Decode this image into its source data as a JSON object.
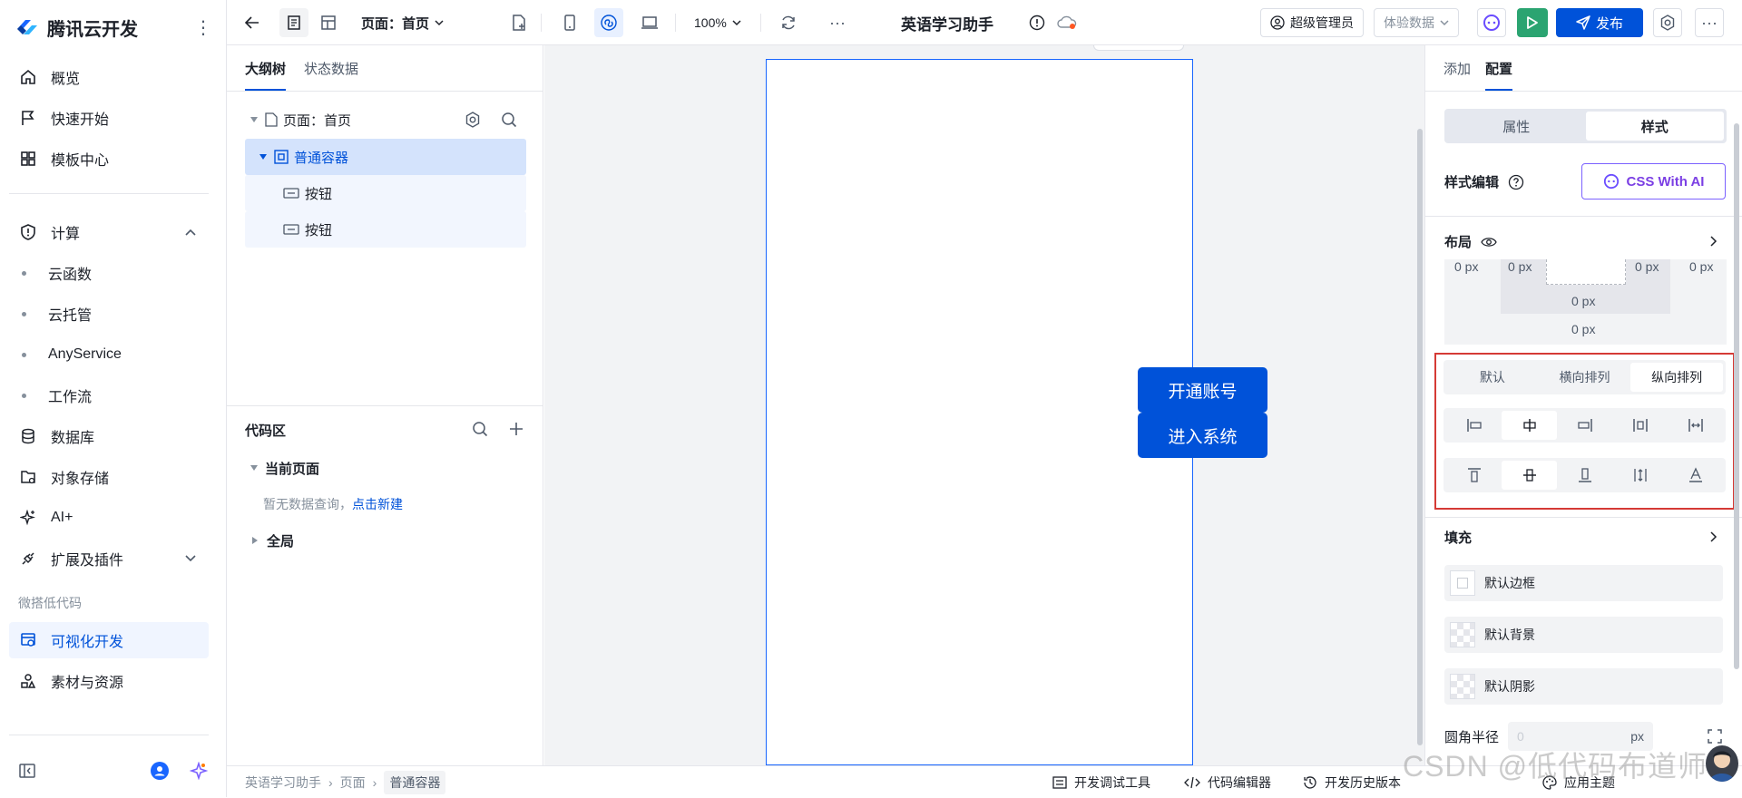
{
  "nav": {
    "brand": "腾讯云开发",
    "items": [
      {
        "label": "概览",
        "icon": "home-icon"
      },
      {
        "label": "快速开始",
        "icon": "flag-icon"
      },
      {
        "label": "模板中心",
        "icon": "grid-icon"
      },
      {
        "label": "计算",
        "icon": "shield-icon"
      },
      {
        "label": "云函数"
      },
      {
        "label": "云托管"
      },
      {
        "label": "AnyService"
      },
      {
        "label": "工作流"
      },
      {
        "label": "数据库",
        "icon": "database-icon"
      },
      {
        "label": "对象存储",
        "icon": "folder-icon"
      },
      {
        "label": "AI+",
        "icon": "sparkle-icon"
      },
      {
        "label": "扩展及插件",
        "icon": "plug-icon"
      },
      {
        "label": "可视化开发",
        "icon": "visual-dev-icon"
      },
      {
        "label": "素材与资源",
        "icon": "assets-icon"
      }
    ],
    "group_label": "微搭低代码",
    "accent": "#0052d9"
  },
  "toolbar": {
    "page_select": "页面：首页",
    "zoom": "100%",
    "app_title": "英语学习助手",
    "user": "超级管理员",
    "data_mode": "体验数据",
    "publish": "发布"
  },
  "outline": {
    "tabs": [
      "大纲树",
      "状态数据"
    ],
    "tree": {
      "page": "页面：首页",
      "container": "普通容器",
      "children": [
        "按钮",
        "按钮"
      ]
    },
    "code": {
      "title": "代码区",
      "current_page": "当前页面",
      "empty_text": "暂无数据查询，",
      "create_link": "点击新建",
      "global": "全局"
    }
  },
  "canvas": {
    "buttons": [
      "开通账号",
      "进入系统"
    ]
  },
  "config": {
    "tabs": [
      "添加",
      "配置"
    ],
    "segment": [
      "属性",
      "样式"
    ],
    "style_edit": "样式编辑",
    "ai_button": "CSS With AI",
    "layout_label": "布局",
    "box_values": {
      "outer_left": "0 px",
      "inner_left": "0 px",
      "inner_right": "0 px",
      "outer_right": "0 px",
      "inner_bottom": "0 px",
      "outer_bottom": "0 px"
    },
    "direction": [
      "默认",
      "横向排列",
      "纵向排列"
    ],
    "fill_label": "填充",
    "fills": [
      "默认边框",
      "默认背景",
      "默认阴影"
    ],
    "radius_label": "圆角半径",
    "radius_placeholder": "0",
    "radius_unit": "px"
  },
  "statusbar": {
    "crumbs": [
      "英语学习助手",
      "页面",
      "普通容器"
    ],
    "debug": "开发调试工具",
    "code_editor": "代码编辑器",
    "history": "开发历史版本",
    "theme": "应用主题"
  },
  "watermark": "CSDN @低代码布道师"
}
